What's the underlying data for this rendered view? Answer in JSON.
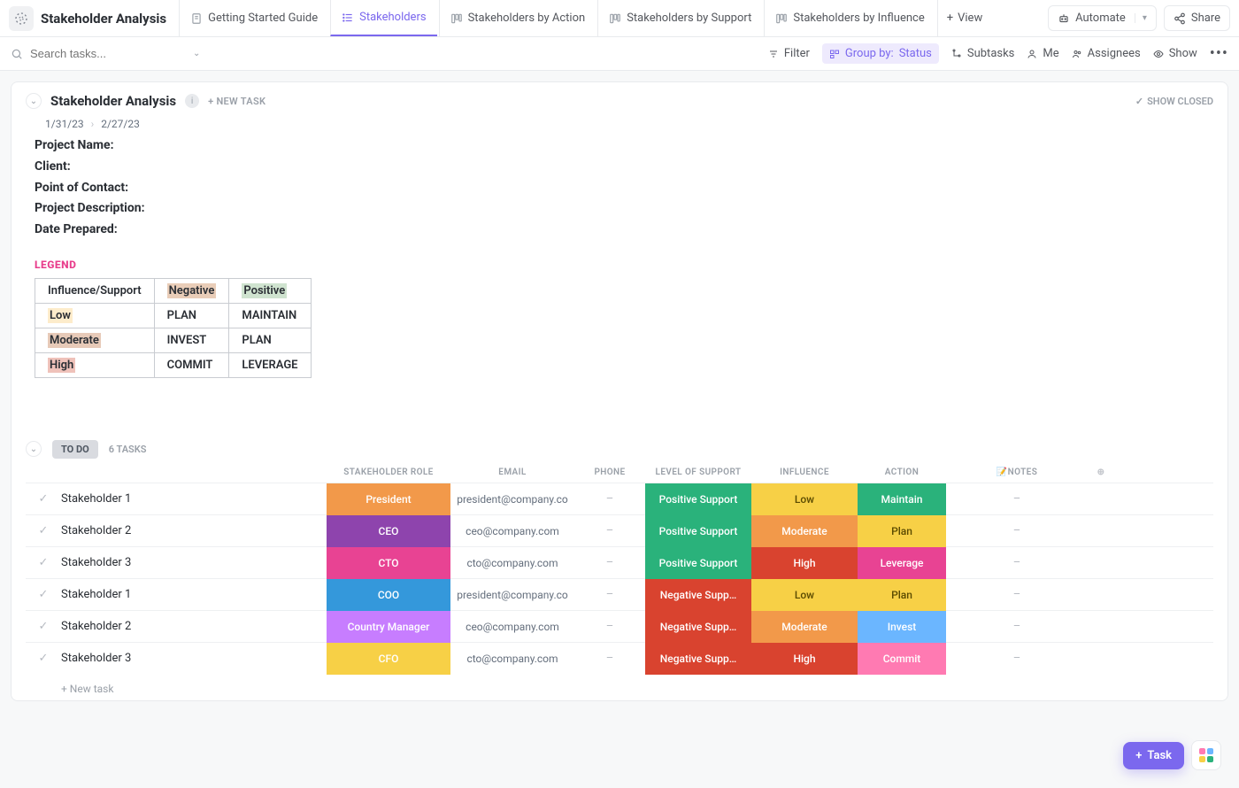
{
  "header": {
    "space_title": "Stakeholder Analysis",
    "tabs": [
      {
        "label": "Getting Started Guide",
        "type": "doc"
      },
      {
        "label": "Stakeholders",
        "type": "list",
        "active": true
      },
      {
        "label": "Stakeholders by Action",
        "type": "board"
      },
      {
        "label": "Stakeholders by Support",
        "type": "board"
      },
      {
        "label": "Stakeholders by Influence",
        "type": "board"
      }
    ],
    "add_view": "View",
    "automate": "Automate",
    "share": "Share"
  },
  "filterbar": {
    "search_placeholder": "Search tasks...",
    "filter": "Filter",
    "group_by_label": "Group by:",
    "group_by_value": "Status",
    "subtasks": "Subtasks",
    "me": "Me",
    "assignees": "Assignees",
    "show": "Show"
  },
  "list": {
    "title": "Stakeholder Analysis",
    "new_task": "+ NEW TASK",
    "show_closed": "SHOW CLOSED",
    "date_start": "1/31/23",
    "date_end": "2/27/23",
    "meta": [
      "Project Name:",
      "Client:",
      "Point of Contact:",
      "Project Description:",
      "Date Prepared:"
    ],
    "legend_title": "LEGEND",
    "legend": {
      "corner": "Influence/Support",
      "cols": [
        "Negative",
        "Positive"
      ],
      "rows": [
        {
          "label": "Low",
          "neg": "PLAN",
          "pos": "MAINTAIN"
        },
        {
          "label": "Moderate",
          "neg": "INVEST",
          "pos": "PLAN"
        },
        {
          "label": "High",
          "neg": "COMMIT",
          "pos": "LEVERAGE"
        }
      ]
    }
  },
  "group": {
    "status": "TO DO",
    "count": "6 TASKS",
    "columns": [
      "STAKEHOLDER ROLE",
      "EMAIL",
      "PHONE",
      "LEVEL OF SUPPORT",
      "INFLUENCE",
      "ACTION",
      "📝NOTES"
    ],
    "rows": [
      {
        "name": "Stakeholder 1",
        "role": {
          "t": "President",
          "c": "#f2994a"
        },
        "email": "president@company.co",
        "phone": "–",
        "support": {
          "t": "Positive Support",
          "c": "#2ab27b"
        },
        "influence": {
          "t": "Low",
          "c": "#f7d046"
        },
        "action": {
          "t": "Maintain",
          "c": "#2ab27b"
        },
        "notes": "–"
      },
      {
        "name": "Stakeholder 2",
        "role": {
          "t": "CEO",
          "c": "#8e44ad"
        },
        "email": "ceo@company.com",
        "phone": "–",
        "support": {
          "t": "Positive Support",
          "c": "#2ab27b"
        },
        "influence": {
          "t": "Moderate",
          "c": "#f2994a"
        },
        "action": {
          "t": "Plan",
          "c": "#f7d046"
        },
        "notes": "–"
      },
      {
        "name": "Stakeholder 3",
        "role": {
          "t": "CTO",
          "c": "#e84393"
        },
        "email": "cto@company.com",
        "phone": "–",
        "support": {
          "t": "Positive Support",
          "c": "#2ab27b"
        },
        "influence": {
          "t": "High",
          "c": "#d9432f"
        },
        "action": {
          "t": "Leverage",
          "c": "#e84393"
        },
        "notes": "–"
      },
      {
        "name": "Stakeholder 1",
        "role": {
          "t": "COO",
          "c": "#3498db"
        },
        "email": "president@company.co",
        "phone": "–",
        "support": {
          "t": "Negative Supp…",
          "c": "#d9432f"
        },
        "influence": {
          "t": "Low",
          "c": "#f7d046"
        },
        "action": {
          "t": "Plan",
          "c": "#f7d046"
        },
        "notes": "–"
      },
      {
        "name": "Stakeholder 2",
        "role": {
          "t": "Country Manager",
          "c": "#c77dff"
        },
        "email": "ceo@company.com",
        "phone": "–",
        "support": {
          "t": "Negative Supp…",
          "c": "#d9432f"
        },
        "influence": {
          "t": "Moderate",
          "c": "#f2994a"
        },
        "action": {
          "t": "Invest",
          "c": "#6bb6ff"
        },
        "notes": "–"
      },
      {
        "name": "Stakeholder 3",
        "role": {
          "t": "CFO",
          "c": "#f7d046"
        },
        "email": "cto@company.com",
        "phone": "–",
        "support": {
          "t": "Negative Supp…",
          "c": "#d9432f"
        },
        "influence": {
          "t": "High",
          "c": "#d9432f"
        },
        "action": {
          "t": "Commit",
          "c": "#ff7ab2"
        },
        "notes": "–"
      }
    ],
    "new_task_row": "+ New task"
  },
  "fab": {
    "task": "Task"
  }
}
